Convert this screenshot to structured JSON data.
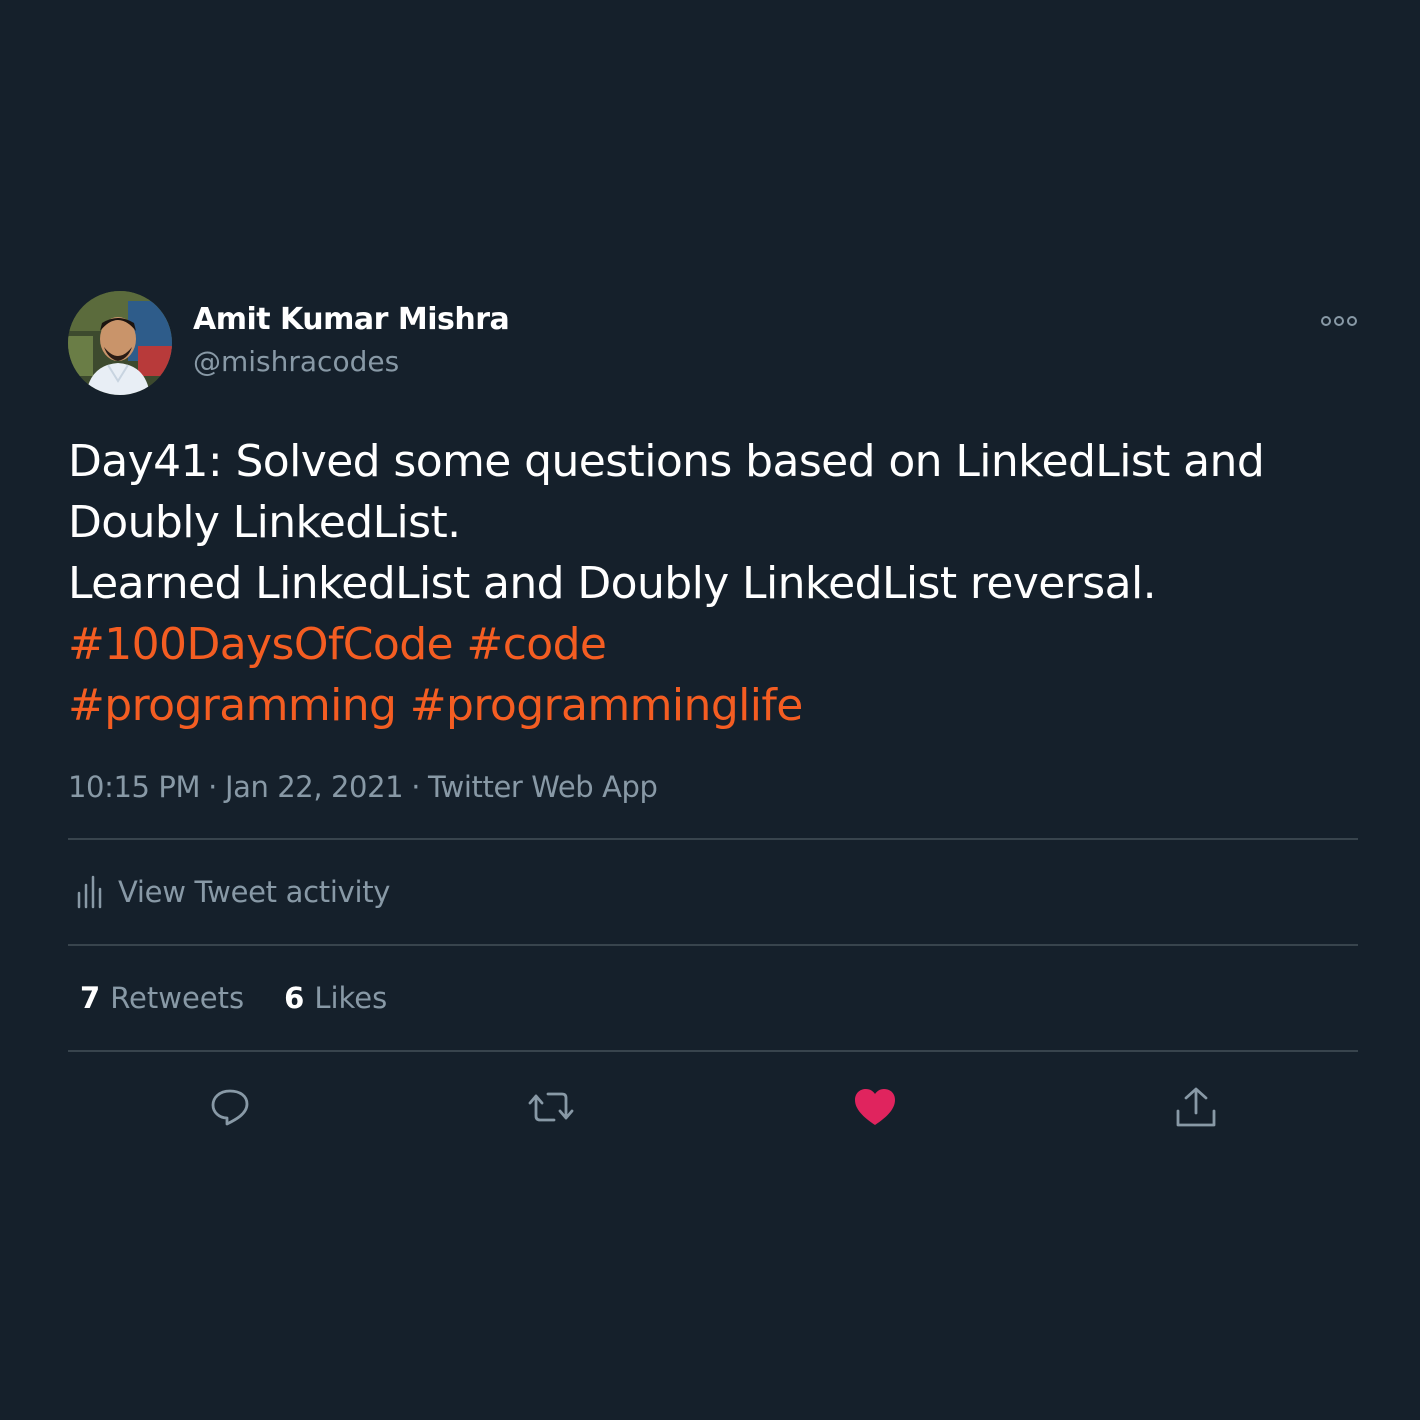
{
  "author": {
    "name": "Amit Kumar Mishra",
    "handle": "@mishracodes"
  },
  "tweet": {
    "lines": [
      "Day41: Solved some questions based on LinkedList and",
      "Doubly LinkedList.",
      "Learned LinkedList and Doubly LinkedList reversal."
    ],
    "hashtags_line1": [
      "#100DaysOfCode",
      "#code"
    ],
    "hashtags_line2": [
      "#programming",
      "#programminglife"
    ]
  },
  "meta": {
    "time": "10:15 PM",
    "date": "Jan 22, 2021",
    "source": "Twitter Web App",
    "separator": "·"
  },
  "activity": {
    "label": "View Tweet activity"
  },
  "stats": {
    "retweets_count": "7",
    "retweets_label": "Retweets",
    "likes_count": "6",
    "likes_label": "Likes"
  },
  "icons": {
    "more": "more-horizontal-icon",
    "activity": "bar-chart-icon",
    "reply": "reply-bubble-icon",
    "retweet": "retweet-icon",
    "like": "heart-filled-icon",
    "share": "share-upload-icon"
  },
  "colors": {
    "background": "#15202b",
    "accent": "#f45d22",
    "muted": "#8899a6",
    "like": "#e0245e",
    "divider": "#38444d"
  }
}
